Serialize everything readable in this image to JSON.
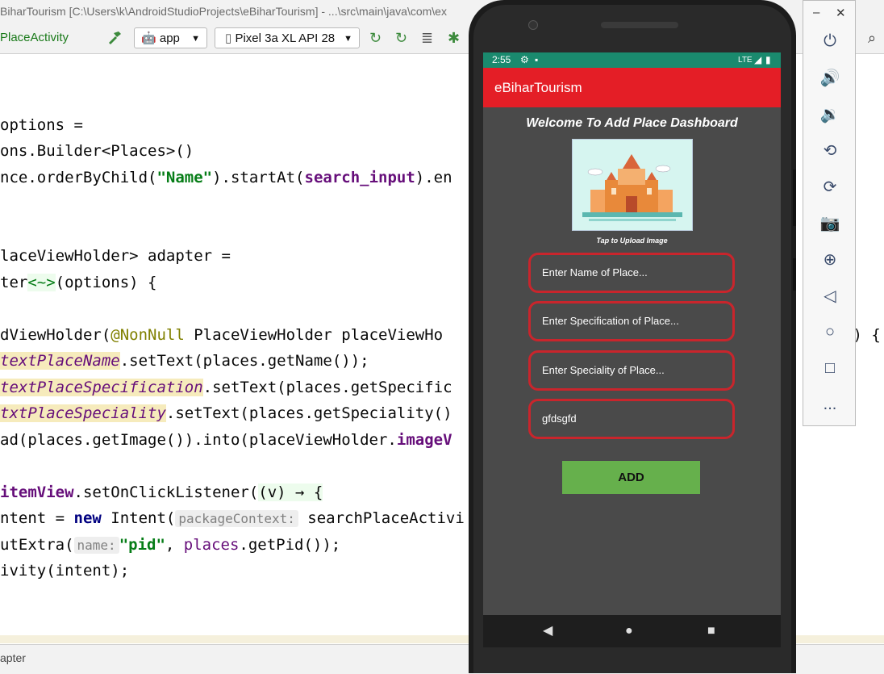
{
  "window": {
    "title": "BiharTourism [C:\\Users\\k\\AndroidStudioProjects\\eBiharTourism] - ...\\src\\main\\java\\com\\ex"
  },
  "toolbar": {
    "activity": "PlaceActivity",
    "run_config": "app",
    "device": "Pixel 3a XL API 28"
  },
  "code": {
    "line1": "options =",
    "line2": "ons.Builder<Places>()",
    "line3a": "nce.orderByChild(",
    "line3b": "\"Name\"",
    "line3c": ").startAt(",
    "line3d": "search_input",
    "line3e": ").en",
    "line4": "laceViewHolder> adapter =",
    "line5a": "ter",
    "line5b": "<~>",
    "line5c": "(options) {",
    "line6a": "dViewHolder(",
    "line6b": "@NonNull",
    "line6c": " PlaceViewHolder placeViewHo",
    "line6d": "s) {",
    "line7a": "textPlaceName",
    "line7b": ".setText(places.getName());",
    "line8a": "textPlaceSpecification",
    "line8b": ".setText(places.getSpecific",
    "line9a": "txtPlaceSpeciality",
    "line9b": ".setText(places.getSpeciality()",
    "line10a": "ad(places.getImage()).into(placeViewHolder.",
    "line10b": "imageV",
    "line11a": "itemView",
    "line11b": ".setOnClickListener(",
    "line11c": "(v) → {",
    "line12a": "ntent = ",
    "line12b": "new",
    "line12c": " Intent(",
    "line12d": "packageContext:",
    "line12e": " searchPlaceActivi",
    "line13a": "utExtra(",
    "line13b": "name:",
    "line13c": "\"pid\"",
    "line13d": ", ",
    "line13e": "places",
    "line13f": ".getPid());",
    "line14": "ivity(intent);"
  },
  "statusbar": {
    "text": "apter"
  },
  "phone": {
    "status": {
      "time": "2:55",
      "network": "LTE"
    },
    "app_title": "eBiharTourism",
    "dashboard_title": "Welcome To Add Place Dashboard",
    "image_caption": "Tap to Upload Image",
    "fields": {
      "name_placeholder": "Enter Name of Place...",
      "specification_placeholder": "Enter Specification of Place...",
      "speciality_placeholder": "Enter Speciality of Place...",
      "fourth_value": "gfdsgfd"
    },
    "add_label": "ADD"
  },
  "emulator_panel": {
    "more_label": "..."
  },
  "colors": {
    "app_bar": "#e41e26",
    "status_bar": "#1a8a6e",
    "add_button": "#66b04c",
    "field_border": "#c9252c"
  }
}
